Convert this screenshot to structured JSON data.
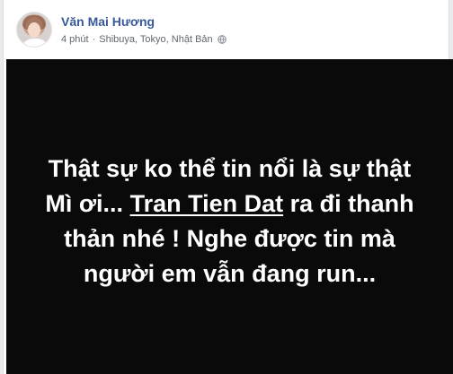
{
  "post": {
    "author": "Văn Mai Hương",
    "time": "4 phút",
    "separator": "·",
    "location": "Shibuya, Tokyo, Nhật Bản",
    "privacy_icon": "globe-icon"
  },
  "photo": {
    "line1": "Thật sự ko thể tin nổi là sự thật",
    "line2_prefix": "Mì ơi... ",
    "line2_link": "Tran Tien Dat",
    "line2_suffix": " ra đi thanh",
    "line3": "thản nhé ! Nghe được tin mà",
    "line4": "người em vẫn đang run..."
  },
  "colors": {
    "author_link": "#385898",
    "meta_text": "#616770",
    "photo_background": "#0a0a0a",
    "photo_text": "#ffffff"
  }
}
